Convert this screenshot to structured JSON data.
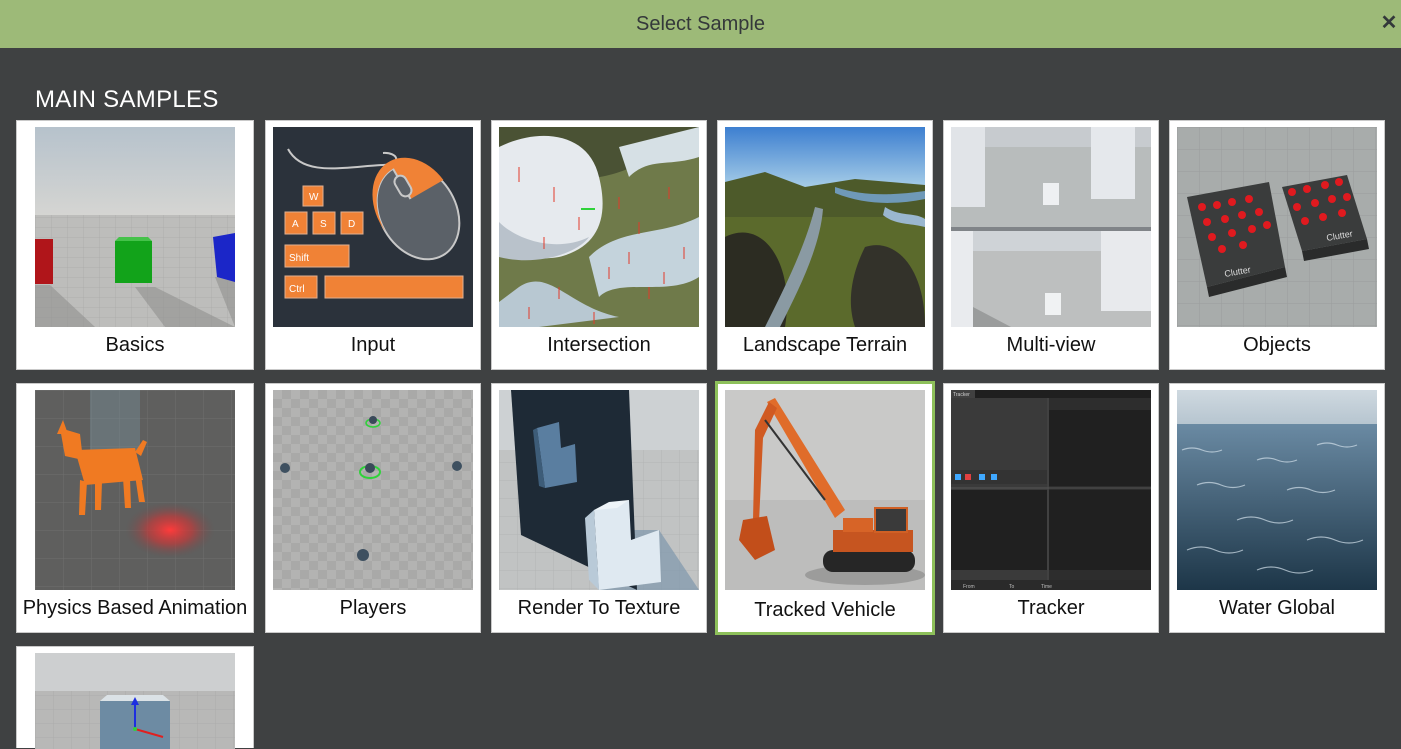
{
  "window": {
    "title": "Select Sample"
  },
  "section": {
    "title": "MAIN SAMPLES"
  },
  "samples": [
    {
      "label": "Basics",
      "icon": "basics-thumbnail"
    },
    {
      "label": "Input",
      "icon": "input-thumbnail",
      "keys": [
        "W",
        "A",
        "S",
        "D",
        "Shift",
        "Ctrl"
      ]
    },
    {
      "label": "Intersection",
      "icon": "intersection-thumbnail"
    },
    {
      "label": "Landscape Terrain",
      "icon": "landscape-terrain-thumbnail"
    },
    {
      "label": "Multi-view",
      "icon": "multi-view-thumbnail"
    },
    {
      "label": "Objects",
      "icon": "objects-thumbnail",
      "tags": [
        "Clutter",
        "Clutter"
      ]
    },
    {
      "label": "Physics Based Animation",
      "icon": "physics-animation-thumbnail"
    },
    {
      "label": "Players",
      "icon": "players-thumbnail"
    },
    {
      "label": "Render To Texture",
      "icon": "render-to-texture-thumbnail"
    },
    {
      "label": "Tracked Vehicle",
      "icon": "tracked-vehicle-thumbnail",
      "selected": true
    },
    {
      "label": "Tracker",
      "icon": "tracker-thumbnail",
      "tab": "Tracker",
      "fields": [
        "From",
        "To",
        "Time"
      ]
    },
    {
      "label": "Water Global",
      "icon": "water-global-thumbnail"
    },
    {
      "label": "",
      "icon": "gizmo-thumbnail"
    }
  ],
  "colors": {
    "header": "#9dba78",
    "background": "#3f4142",
    "selected_border": "#8dc05a"
  }
}
